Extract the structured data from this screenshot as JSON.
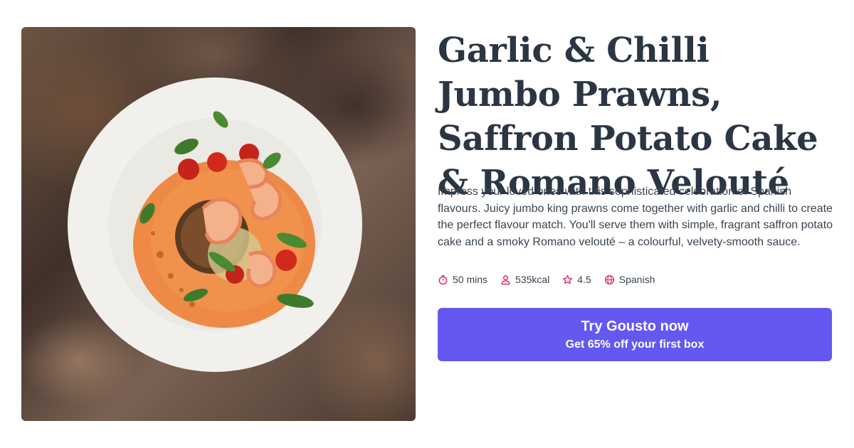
{
  "recipe": {
    "title": "Garlic & Chilli Jumbo Prawns, Saffron Potato Cake & Romano Velouté",
    "description": "Impress your loved ones with this sophisticated celebration of Spanish flavours. Juicy jumbo king prawns come together with garlic and chilli to create the perfect flavour match. You'll serve them with simple, fragrant saffron potato cake and a smoky Romano velouté – a colourful, velvety-smooth sauce.",
    "meta": {
      "time": "50 mins",
      "calories": "535kcal",
      "rating": "4.5",
      "cuisine": "Spanish"
    },
    "icons": [
      "timer-icon",
      "person-icon",
      "star-icon",
      "globe-icon"
    ]
  },
  "cta": {
    "main_label": "Try Gousto now",
    "sub_label": "Get 65% off your first box"
  },
  "colors": {
    "accent": "#6358f0",
    "icon_accent": "#e0245e",
    "title": "#2b3644"
  }
}
